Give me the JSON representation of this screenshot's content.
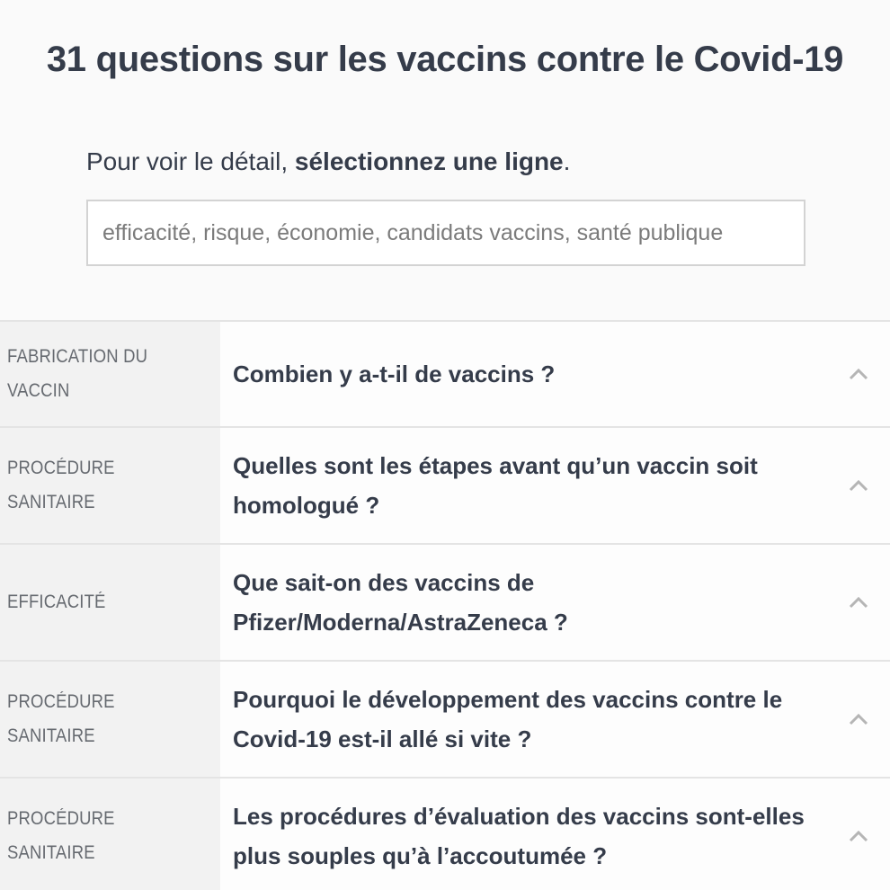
{
  "header": {
    "title": "31 questions sur les vaccins contre le Covid-19"
  },
  "instruction": {
    "prefix": "Pour voir le détail, ",
    "bold": "sélectionnez une ligne",
    "suffix": "."
  },
  "search": {
    "placeholder": "efficacité, risque, économie, candidats vaccins, santé publique"
  },
  "faq": {
    "rows": [
      {
        "category": "Fabrication du vaccin",
        "question": "Combien y a-t-il de vaccins ?"
      },
      {
        "category": "Procédure sanitaire",
        "question": "Quelles sont les étapes avant qu’un vaccin soit homologué ?"
      },
      {
        "category": "Efficacité",
        "question": "Que sait-on des vaccins de Pfizer/Moderna/AstraZeneca ?"
      },
      {
        "category": "Procédure sanitaire",
        "question": "Pourquoi le développement des vaccins contre le Covid-19 est-il allé si vite ?"
      },
      {
        "category": "Procédure sanitaire",
        "question": "Les procédures d’évaluation des vaccins sont-elles plus souples qu’à l’accoutumée ?"
      }
    ]
  },
  "icons": {
    "row_toggle": "chevron-up-icon"
  },
  "colors": {
    "text": "#353c4a",
    "category_text": "#666a70",
    "category_bg": "#f2f2f2",
    "border": "#e4e4e4",
    "chevron": "#b5b5b5"
  }
}
